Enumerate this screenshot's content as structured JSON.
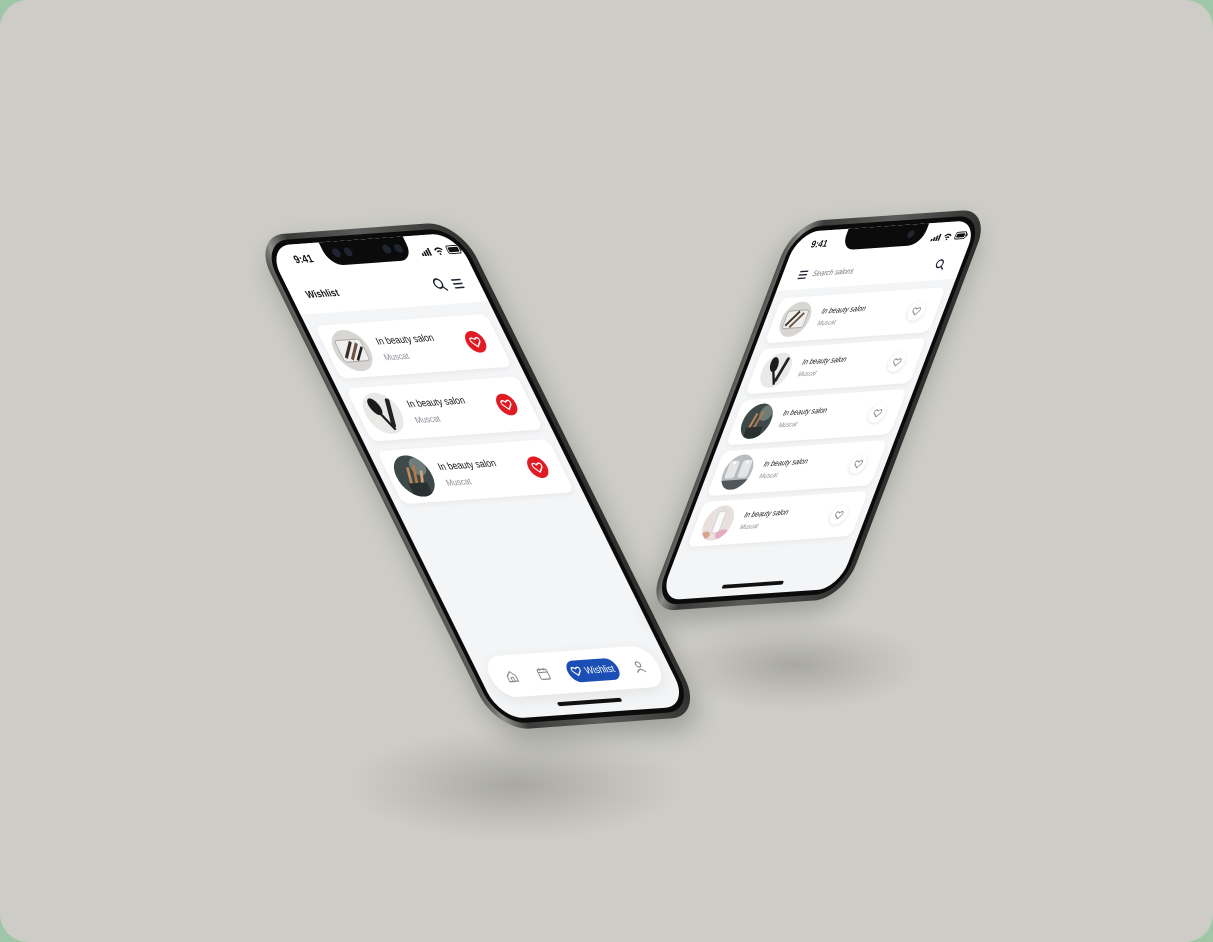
{
  "colors": {
    "background": "#cdccc6",
    "heart_active": "#e01b24",
    "tab_active": "#1c4fb5",
    "text_primary": "#151515",
    "text_secondary": "#8a8d93"
  },
  "wishlist_phone": {
    "status": {
      "time": "9:41",
      "icons": [
        "signal-icon",
        "wifi-icon",
        "battery-icon"
      ]
    },
    "header": {
      "title": "Wishlist",
      "icons": [
        "search-icon",
        "menu-icon"
      ]
    },
    "items": [
      {
        "name": "In beauty salon",
        "city": "Muscat",
        "image": "makeup-brushes-tray",
        "favorited": true
      },
      {
        "name": "In beauty salon",
        "city": "Muscat",
        "image": "hair-brush-comb",
        "favorited": true
      },
      {
        "name": "In beauty salon",
        "city": "Muscat",
        "image": "brushes-in-cup",
        "favorited": true
      }
    ],
    "tabbar": {
      "tabs": [
        {
          "icon": "home-icon"
        },
        {
          "icon": "calendar-icon"
        },
        {
          "icon": "heart-icon",
          "label": "Wishlist",
          "active": true
        },
        {
          "icon": "profile-icon"
        }
      ]
    }
  },
  "search_phone": {
    "status": {
      "time": "9:41",
      "icons": [
        "signal-icon",
        "wifi-icon",
        "battery-icon"
      ]
    },
    "search": {
      "placeholder": "Search salons",
      "icons": [
        "menu-icon",
        "search-icon"
      ]
    },
    "items": [
      {
        "name": "In beauty salon",
        "city": "Muscat",
        "image": "makeup-brushes-tray",
        "favorited": false
      },
      {
        "name": "In beauty salon",
        "city": "Muscat",
        "image": "hair-brush-comb",
        "favorited": false
      },
      {
        "name": "In beauty salon",
        "city": "Muscat",
        "image": "brushes-in-cup",
        "favorited": false
      },
      {
        "name": "In beauty salon",
        "city": "Muscat",
        "image": "salon-mirrors",
        "favorited": false
      },
      {
        "name": "In beauty salon",
        "city": "Muscat",
        "image": "cosmetics-bottles",
        "favorited": false
      }
    ]
  }
}
